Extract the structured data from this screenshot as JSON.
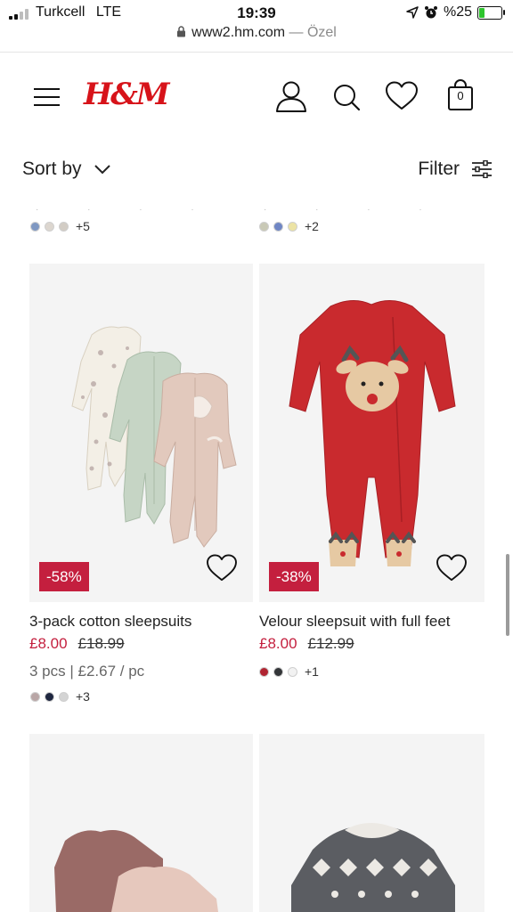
{
  "status_bar": {
    "carrier": "Turkcell",
    "network": "LTE",
    "time": "19:39",
    "battery": "%25",
    "battery_level_percent": 25,
    "battery_color": "#2ec52e"
  },
  "browser": {
    "url": "www2.hm.com",
    "mode": "— Özel"
  },
  "header": {
    "logo": "H&M",
    "brand_color": "#d7131a",
    "icons": [
      "menu-icon",
      "account-icon",
      "search-icon",
      "heart-icon",
      "shopping-bag-icon"
    ],
    "bag_count": "0"
  },
  "toolbar": {
    "sort_label": "Sort by",
    "filter_label": "Filter"
  },
  "previous_row": [
    {
      "swatches": [
        "#7f98c2",
        "#dcd6cf",
        "#d2ccc4"
      ],
      "more": "+5"
    },
    {
      "swatches": [
        "#c9c9b6",
        "#6f86c4",
        "#ece3a4"
      ],
      "more": "+2"
    }
  ],
  "products": [
    {
      "discount": "-58%",
      "name": "3-pack cotton sleepsuits",
      "sale_price": "£8.00",
      "original_price": "£18.99",
      "pack_info": "3 pcs | £2.67 / pc",
      "swatches": [
        "#b9a6a6",
        "#1f2740",
        "#d4d4d4"
      ],
      "more": "+3"
    },
    {
      "discount": "-38%",
      "name": "Velour sleepsuit with full feet",
      "sale_price": "£8.00",
      "original_price": "£12.99",
      "swatches": [
        "#b02431",
        "#333538",
        "#f2f2f2"
      ],
      "more": "+1"
    }
  ],
  "colors": {
    "sale_red": "#c41f3e",
    "card_bg": "#f4f4f4"
  }
}
